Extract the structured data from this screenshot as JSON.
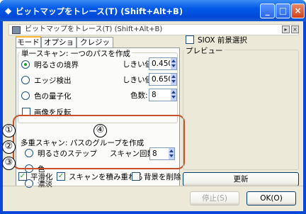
{
  "window": {
    "title": "ビットマップをトレース(T)  (Shift+Alt+B)"
  },
  "subbar": {
    "title": "ビットマップをトレース(T) (Shift+Alt+B)"
  },
  "tabs": [
    {
      "label": "モード"
    },
    {
      "label": "オプション"
    },
    {
      "label": "クレジット"
    }
  ],
  "single_scan": {
    "title": "単一スキャン: 一つのパスを作成",
    "options": [
      {
        "label": "明るさの境界",
        "param_label": "しきい値:",
        "value": "0.450",
        "selected": true
      },
      {
        "label": "エッジ検出",
        "param_label": "しきい値:",
        "value": "0.650",
        "selected": false
      },
      {
        "label": "色の量子化",
        "param_label": "色数:",
        "value": "8",
        "selected": false
      }
    ],
    "invert_label": "画像を反転"
  },
  "multi_scan": {
    "title": "多重スキャン: パスのグループを作成",
    "options": [
      {
        "label": "明るさのステップ",
        "selected": false
      },
      {
        "label": "色",
        "selected": false
      },
      {
        "label": "濃淡",
        "selected": false
      }
    ],
    "scans_label": "スキャン回数:",
    "scans_value": "8",
    "annotations": [
      "①",
      "②",
      "③",
      "④"
    ]
  },
  "bottom_options": [
    {
      "label": "平滑化",
      "checked": true
    },
    {
      "label": "スキャンを積み重ねる",
      "checked": true
    },
    {
      "label": "背景を削除",
      "checked": false
    }
  ],
  "siox_label": "SIOX 前景選択",
  "preview": {
    "title": "プレビュー",
    "update_label": "更新"
  },
  "buttons": {
    "stop": "停止(S)",
    "ok": "OK(O)"
  },
  "colors": {
    "titlebar": "#0058e6",
    "accent_green": "#21a121",
    "annotation_border": "#c8502a"
  }
}
